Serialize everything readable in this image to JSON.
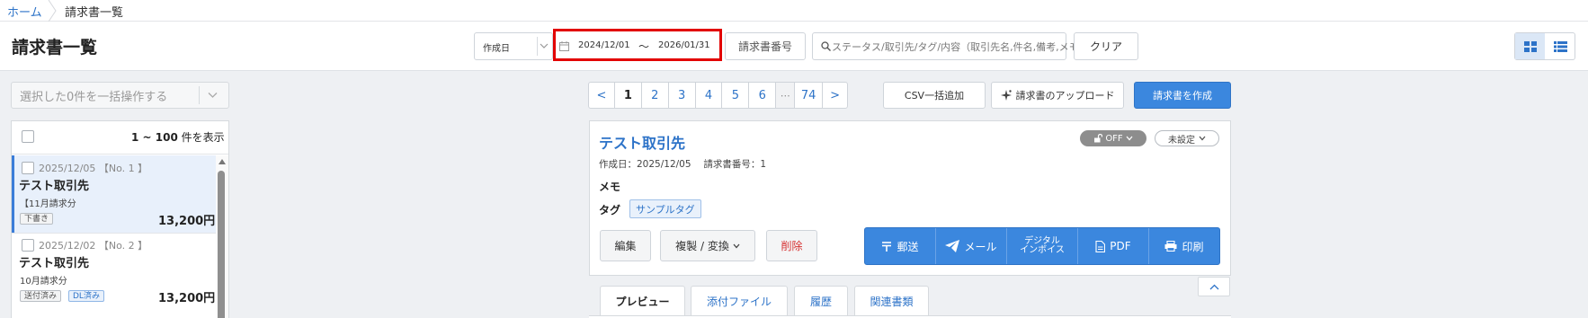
{
  "breadcrumb": {
    "home": "ホーム",
    "current": "請求書一覧"
  },
  "header": {
    "title": "請求書一覧",
    "date_type": "作成日",
    "date_from": "2024/12/01",
    "date_tilde": "〜",
    "date_to": "2026/01/31",
    "invoice_number_label": "請求書番号",
    "search_placeholder": "ステータス/取引先/タグ/内容（取引先名,件名,備考,メモ）",
    "clear_label": "クリア"
  },
  "left": {
    "bulk_placeholder": "選択した0件を一括操作する",
    "range_prefix": "1 ~ 100",
    "range_suffix": " 件を表示",
    "items": [
      {
        "meta": "2025/12/05 【No. 1 】",
        "name": "テスト取引先",
        "subject": "【11月請求分",
        "tags": [
          "下書き"
        ],
        "amount": "13,200円"
      },
      {
        "meta": "2025/12/02 【No. 2 】",
        "name": "テスト取引先",
        "subject": "10月請求分",
        "tags": [
          "送付済み",
          "DL済み"
        ],
        "amount": "13,200円"
      }
    ]
  },
  "pagination": {
    "prev": "<",
    "pages": [
      "1",
      "2",
      "3",
      "4",
      "5",
      "6"
    ],
    "ellipsis": "⋯",
    "last": "74",
    "next": ">"
  },
  "toolbar": {
    "csv_label": "CSV一括追加",
    "upload_label": "請求書のアップロード",
    "create_label": "請求書を作成"
  },
  "detail": {
    "client_name": "テスト取引先",
    "lock_label": "OFF",
    "status_label": "未設定",
    "meta": "作成日：2025/12/05　 請求書番号：1",
    "memo_label": "メモ",
    "tag_label": "タグ",
    "sample_tag": "サンプルタグ",
    "edit_label": "編集",
    "duplicate_label": "複製 / 変換",
    "delete_label": "削除",
    "actions": {
      "mail": "郵送",
      "email": "メール",
      "digital_line1": "デジタル",
      "digital_line2": "インボイス",
      "pdf": "PDF",
      "print": "印刷"
    }
  },
  "tabs": {
    "preview": "プレビュー",
    "attachments": "添付ファイル",
    "history": "履歴",
    "related": "関連書類"
  },
  "colors": {
    "accent": "#3b87de",
    "link": "#2d73c8",
    "highlight": "#e20000",
    "danger": "#d63030"
  }
}
